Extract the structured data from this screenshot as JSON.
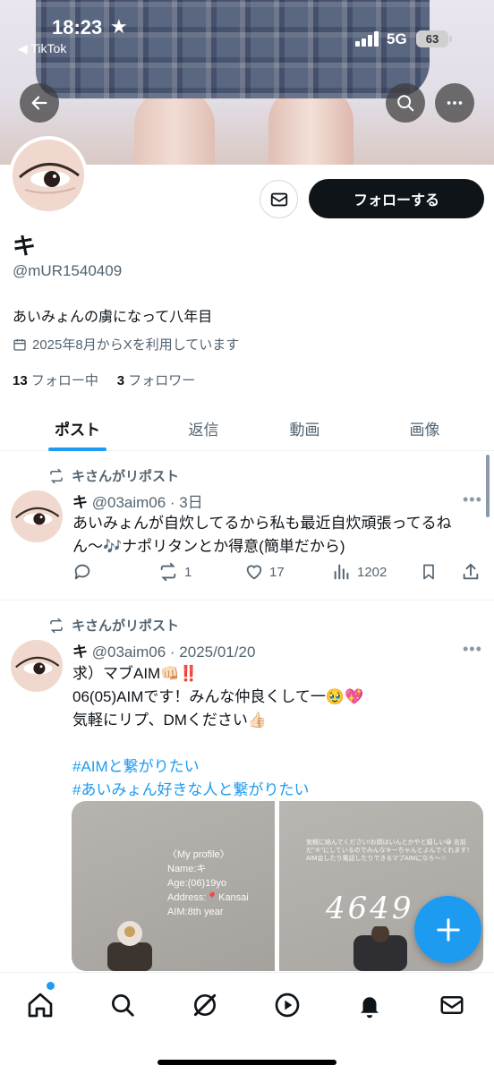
{
  "status_bar": {
    "time": "18:23",
    "back_app": "◀ TikTok",
    "network": "5G",
    "battery": "63"
  },
  "profile": {
    "display_name": "キ",
    "handle": "@mUR1540409",
    "bio": "あいみょんの虜になって八年目",
    "joined": "2025年8月からXを利用しています",
    "following_count": "13",
    "following_label": "フォロー中",
    "followers_count": "3",
    "followers_label": "フォロワー",
    "follow_button": "フォローする"
  },
  "tabs": [
    {
      "label": "ポスト"
    },
    {
      "label": "返信"
    },
    {
      "label": "動画"
    },
    {
      "label": "画像"
    }
  ],
  "posts": [
    {
      "repost_label": "キさんがリポスト",
      "name": "キ",
      "handle_time": "@03aim06 · 3日",
      "text": "あいみょんが自炊してるから私も最近自炊頑張ってるねん〜🎶ナポリタンとか得意(簡単だから)",
      "replies": "",
      "reposts": "1",
      "likes": "17",
      "views": "1202"
    },
    {
      "repost_label": "キさんがリポスト",
      "name": "キ",
      "handle_time": "@03aim06 · 2025/01/20",
      "line1": "求）マブAIM👊🏻‼️",
      "line2": "06(05)AIMです！みんな仲良くして一🥹💖",
      "line3": "気軽にリプ、DMください👍🏻",
      "hashtag1": "#AIMと繋がりたい",
      "hashtag2": "#あいみょん好きな人と繋がりたい",
      "image1": {
        "title": "〈My profile〉",
        "name": "Name:キ",
        "age": "Age:(06)19yo",
        "address": "Address:📍Kansai",
        "aim": "AIM:8th year"
      },
      "image2": {
        "caption": "気軽に絡んでください!お顔はいんとかやと嬉しい😀 名前だ\"キ\"にしているのでみんなキーちゃんとよんでくれます！ AIM会したり電話したりできるマブAIMになろ〜☆",
        "number": "4649"
      }
    }
  ],
  "colors": {
    "accent": "#1d9bf0",
    "text": "#0f1419",
    "secondary": "#536471"
  }
}
